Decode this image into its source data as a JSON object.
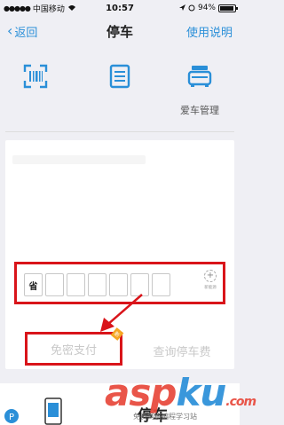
{
  "status_bar": {
    "carrier": "中国移动",
    "time": "10:57",
    "battery": "94%",
    "battery_level": 0.94
  },
  "nav": {
    "back_label": "返回",
    "title": "停车",
    "help_label": "使用说明"
  },
  "functions": [
    {
      "icon": "scan-icon",
      "label": ""
    },
    {
      "icon": "list-icon",
      "label": ""
    },
    {
      "icon": "car-icon",
      "label": "爱车管理"
    }
  ],
  "plate": {
    "province": "省",
    "cell_count": 6,
    "add_label": "新能源"
  },
  "buttons": {
    "pay_label": "免密支付",
    "pay_badge": "新",
    "query_label": "查询停车费"
  },
  "bottom": {
    "title": "停车"
  },
  "watermark": {
    "brand_a": "asp",
    "brand_b": "ku",
    "brand_c": ".com",
    "sub": "免费网络编程学习站"
  },
  "colors": {
    "accent": "#2a8fd8",
    "highlight": "#d9141a"
  }
}
